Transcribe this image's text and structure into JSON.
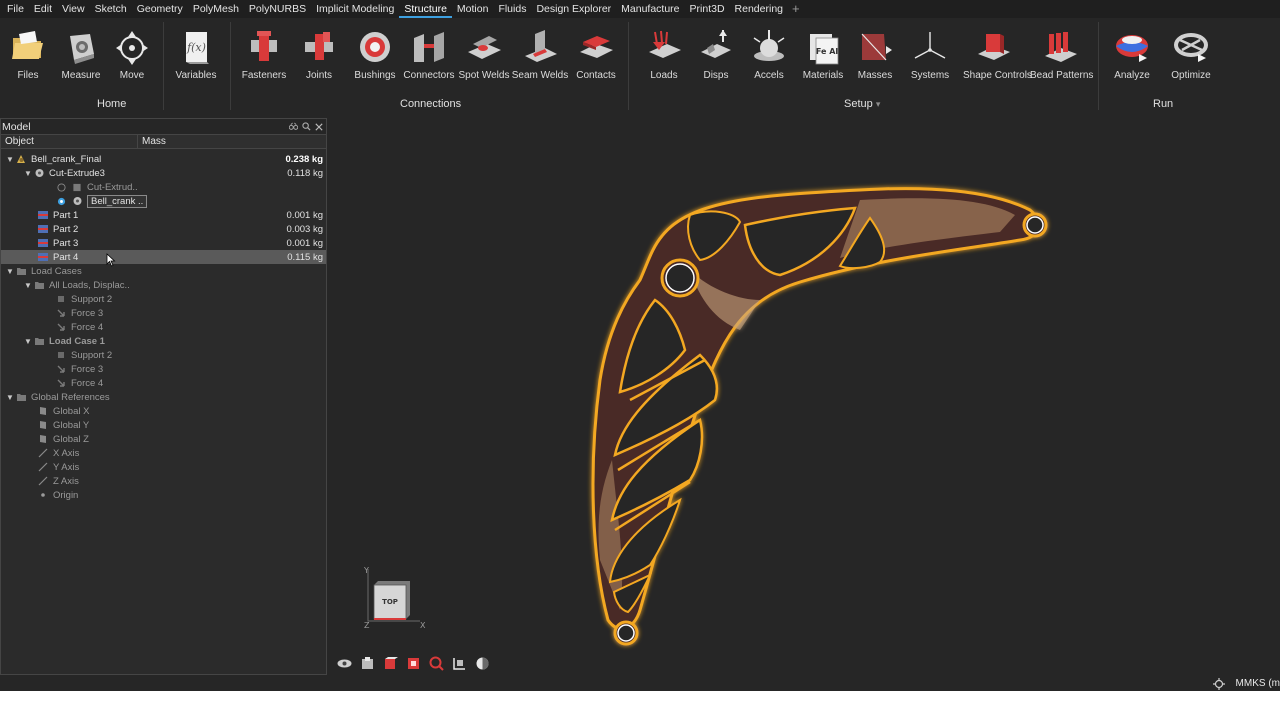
{
  "menu": {
    "items": [
      "File",
      "Edit",
      "View",
      "Sketch",
      "Geometry",
      "PolyMesh",
      "PolyNURBS",
      "Implicit Modeling",
      "Structure",
      "Motion",
      "Fluids",
      "Design Explorer",
      "Manufacture",
      "Print3D",
      "Rendering"
    ],
    "active": "Structure",
    "plus_glyph": "+"
  },
  "ribbon": {
    "groups": {
      "home": "Home",
      "connections": "Connections",
      "setup": "Setup",
      "setup_arrow": "▾",
      "run": "Run"
    },
    "tools": {
      "files": "Files",
      "measure": "Measure",
      "move": "Move",
      "variables": "Variables",
      "fasteners": "Fasteners",
      "joints": "Joints",
      "bushings": "Bushings",
      "connectors": "Connectors",
      "spot_welds": "Spot Welds",
      "seam_welds": "Seam Welds",
      "contacts": "Contacts",
      "loads": "Loads",
      "disps": "Disps",
      "accels": "Accels",
      "materials": "Materials",
      "masses": "Masses",
      "systems": "Systems",
      "shape_controls": "Shape Controls",
      "bead_patterns": "Bead Patterns",
      "analyze": "Analyze",
      "optimize": "Optimize"
    },
    "variables_glyph": "f(x)",
    "materials_glyph": "Fe Al"
  },
  "model_browser": {
    "title": "Model",
    "columns": {
      "object": "Object",
      "mass": "Mass"
    },
    "tree": {
      "root": {
        "label": "Bell_crank_Final",
        "mass": "0.238 kg"
      },
      "cut_extrude3": {
        "label": "Cut-Extrude3",
        "mass": "0.118 kg"
      },
      "cut_extrude_child": {
        "label": "Cut-Extrud.."
      },
      "bell_crank_child": {
        "label": "Bell_crank .."
      },
      "part1": {
        "label": "Part 1",
        "mass": "0.001 kg"
      },
      "part2": {
        "label": "Part 2",
        "mass": "0.003 kg"
      },
      "part3": {
        "label": "Part 3",
        "mass": "0.001 kg"
      },
      "part4": {
        "label": "Part 4",
        "mass": "0.115 kg"
      },
      "load_cases": {
        "label": "Load Cases"
      },
      "all_loads": {
        "label": "All Loads, Displac.."
      },
      "all_support2": {
        "label": "Support 2"
      },
      "all_force3": {
        "label": "Force 3"
      },
      "all_force4": {
        "label": "Force 4"
      },
      "load_case1": {
        "label": "Load Case 1"
      },
      "lc1_support2": {
        "label": "Support 2"
      },
      "lc1_force3": {
        "label": "Force 3"
      },
      "lc1_force4": {
        "label": "Force 4"
      },
      "global_refs": {
        "label": "Global References"
      },
      "global_x": {
        "label": "Global X"
      },
      "global_y": {
        "label": "Global Y"
      },
      "global_z": {
        "label": "Global Z"
      },
      "x_axis": {
        "label": "X Axis"
      },
      "y_axis": {
        "label": "Y Axis"
      },
      "z_axis": {
        "label": "Z Axis"
      },
      "origin": {
        "label": "Origin"
      }
    }
  },
  "viewport": {
    "viewcube": {
      "face": "TOP",
      "y": "Y",
      "x": "X",
      "z": "Z"
    },
    "part_color": "#e8a11a",
    "part_dark": "#4a2a26"
  },
  "status": {
    "units": "MMKS (m"
  },
  "colors": {
    "accent": "#3da0e0",
    "background": "#262626",
    "selection": "#5a5a5a"
  }
}
